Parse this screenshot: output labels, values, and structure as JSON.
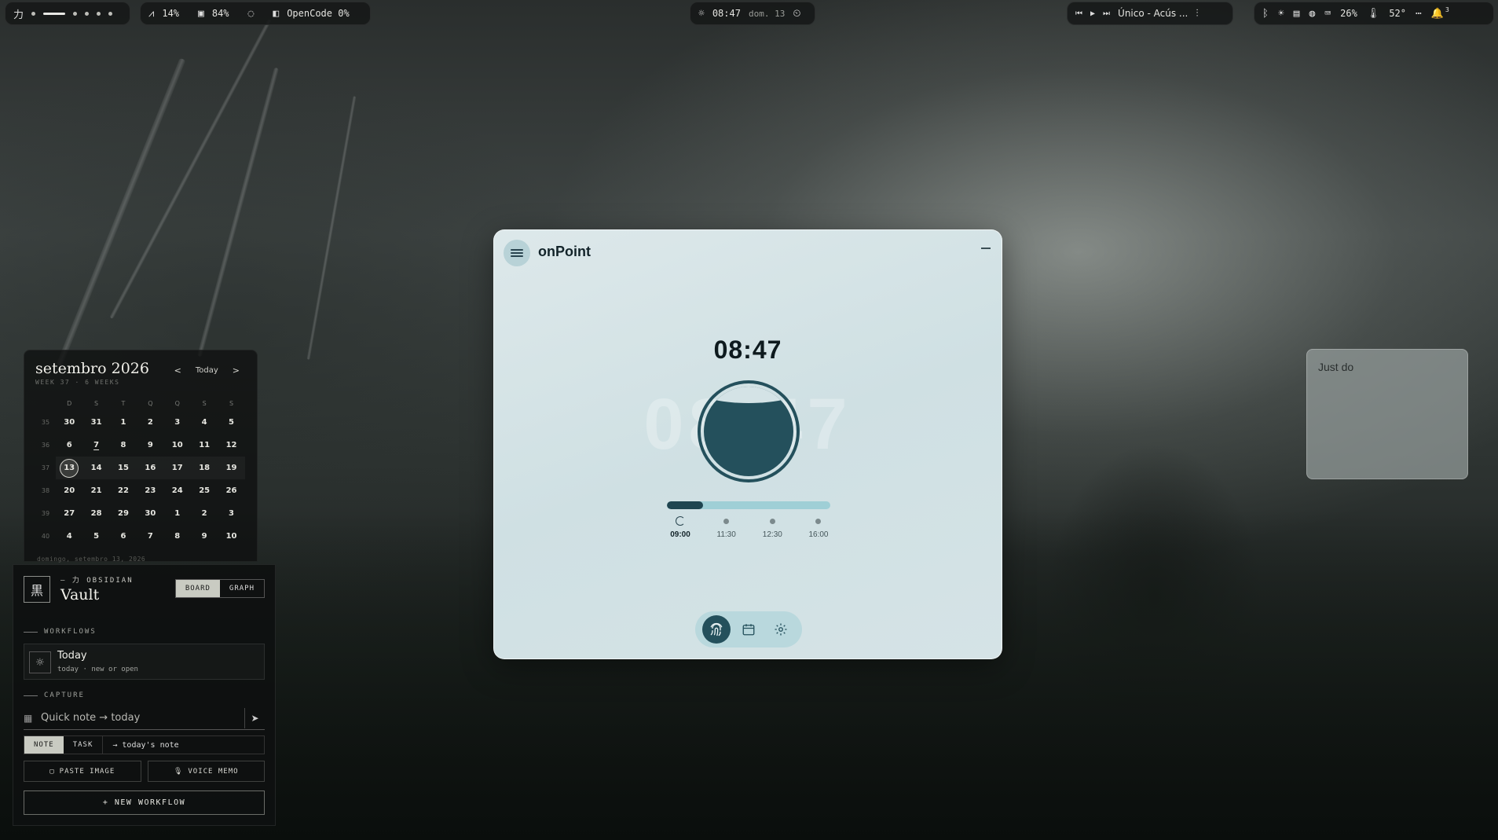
{
  "topbar": {
    "workspace_glyph": "力",
    "cpu": "14%",
    "memory": "84%",
    "opencode": "OpenCode 0%",
    "clock_time": "08:47",
    "clock_date": "dom. 13",
    "media_title": "Único - Acús ...",
    "brightness_pct": "26%",
    "temperature": "52°",
    "notification_count": "3"
  },
  "calendar": {
    "title": "setembro 2026",
    "subtitle": "WEEK 37 · 6 WEEKS",
    "prev": "<",
    "today_label": "Today",
    "next": ">",
    "weekdays": [
      "D",
      "S",
      "T",
      "Q",
      "Q",
      "S",
      "S"
    ],
    "weeks": [
      {
        "wk": "35",
        "days": [
          "30",
          "31",
          "1",
          "2",
          "3",
          "4",
          "5"
        ]
      },
      {
        "wk": "36",
        "days": [
          "6",
          "7",
          "8",
          "9",
          "10",
          "11",
          "12"
        ]
      },
      {
        "wk": "37",
        "days": [
          "13",
          "14",
          "15",
          "16",
          "17",
          "18",
          "19"
        ]
      },
      {
        "wk": "38",
        "days": [
          "20",
          "21",
          "22",
          "23",
          "24",
          "25",
          "26"
        ]
      },
      {
        "wk": "39",
        "days": [
          "27",
          "28",
          "29",
          "30",
          "1",
          "2",
          "3"
        ]
      },
      {
        "wk": "40",
        "days": [
          "4",
          "5",
          "6",
          "7",
          "8",
          "9",
          "10"
        ]
      }
    ],
    "footer": "domingo, setembro 13, 2026"
  },
  "vault": {
    "logo_glyph": "黒",
    "kicker": "力 OBSIDIAN",
    "title": "Vault",
    "board_label": "BOARD",
    "graph_label": "GRAPH",
    "workflows_label": "WORKFLOWS",
    "workflow_today_title": "Today",
    "workflow_today_sub": "today · new or open",
    "capture_label": "CAPTURE",
    "quick_note_placeholder": "Quick note → today",
    "note_label": "NOTE",
    "task_label": "TASK",
    "target_label": "→ today's note",
    "paste_image_label": "PASTE IMAGE",
    "voice_memo_label": "VOICE MEMO",
    "new_workflow_label": "+ NEW WORKFLOW"
  },
  "onpoint": {
    "title": "onPoint",
    "time": "08:47",
    "progress": 0.22,
    "slots": [
      "09:00",
      "11:30",
      "12:30",
      "16:00"
    ],
    "current_slot": 0
  },
  "sticky": {
    "text": "Just do"
  },
  "colors": {
    "accent": "#24505c",
    "window_bg": "#d5e3e6",
    "track": "#9fcfd6"
  }
}
